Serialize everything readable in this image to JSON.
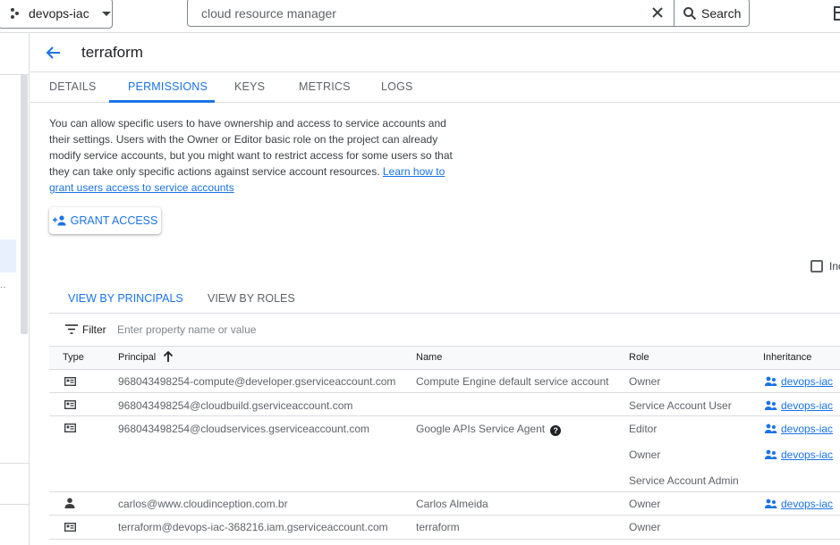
{
  "topbar": {
    "project_name": "devops-iac",
    "search_value": "cloud resource manager",
    "search_button": "Search"
  },
  "header": {
    "title": "terraform"
  },
  "tabs": [
    "DETAILS",
    "PERMISSIONS",
    "KEYS",
    "METRICS",
    "LOGS"
  ],
  "active_tab": "PERMISSIONS",
  "description": {
    "text": "You can allow specific users to have ownership and access to service accounts and their settings. Users with the Owner or Editor basic role on the project can already modify service accounts, but you might want to restrict access for some users so that they can take only specific actions against service account resources.",
    "link": "Learn how to grant users access to service accounts"
  },
  "grant_access_label": "GRANT ACCESS",
  "include_checkbox_label": "Inc",
  "view_tabs": [
    "VIEW BY PRINCIPALS",
    "VIEW BY ROLES"
  ],
  "filter": {
    "label": "Filter",
    "placeholder": "Enter property name or value"
  },
  "table": {
    "columns": [
      "Type",
      "Principal",
      "Name",
      "Role",
      "Inheritance"
    ],
    "rows": [
      {
        "type": "service-account",
        "principal": "968043498254-compute@developer.gserviceaccount.com",
        "name": "Compute Engine default service account",
        "roles": [
          "Owner"
        ],
        "inheritance": [
          "devops-iac"
        ]
      },
      {
        "type": "service-account",
        "principal": "968043498254@cloudbuild.gserviceaccount.com",
        "name": "",
        "roles": [
          "Service Account User"
        ],
        "inheritance": [
          "devops-iac"
        ]
      },
      {
        "type": "service-account",
        "principal": "968043498254@cloudservices.gserviceaccount.com",
        "name": "Google APIs Service Agent",
        "roles": [
          "Editor",
          "Owner",
          "Service Account Admin"
        ],
        "inheritance": [
          "devops-iac",
          "devops-iac",
          ""
        ]
      },
      {
        "type": "user",
        "principal": "carlos@www.cloudinception.com.br",
        "name": "Carlos Almeida",
        "roles": [
          "Owner"
        ],
        "inheritance": [
          "devops-iac"
        ]
      },
      {
        "type": "service-account",
        "principal": "terraform@devops-iac-368216.iam.gserviceaccount.com",
        "name": "terraform",
        "roles": [
          "Owner"
        ],
        "inheritance": [
          ""
        ]
      }
    ]
  }
}
